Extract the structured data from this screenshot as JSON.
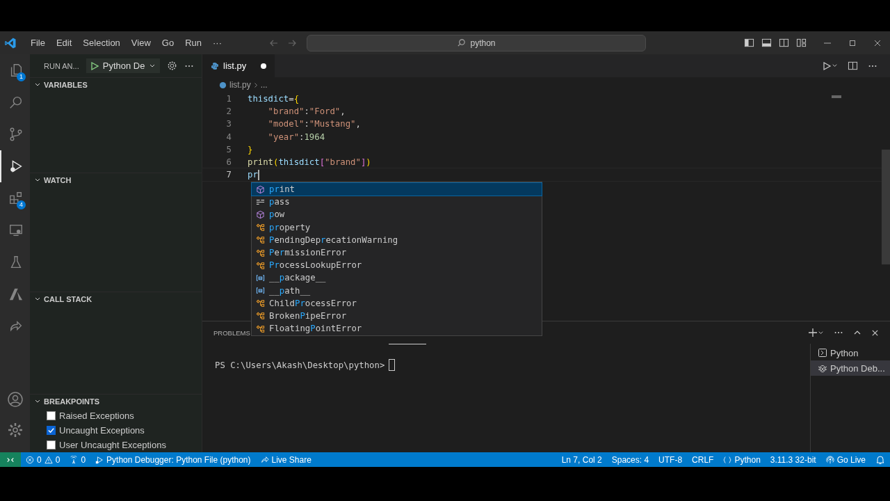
{
  "menu": [
    "File",
    "Edit",
    "Selection",
    "View",
    "Go",
    "Run",
    "···"
  ],
  "search": {
    "value": "python"
  },
  "activity_bar": [
    {
      "kind": "explorer",
      "badge": "1",
      "selected": false
    },
    {
      "kind": "search",
      "selected": false
    },
    {
      "kind": "scm",
      "selected": false
    },
    {
      "kind": "debug",
      "selected": true
    },
    {
      "kind": "extensions",
      "badge": "4",
      "selected": false
    },
    {
      "kind": "remote",
      "selected": false
    },
    {
      "kind": "testing",
      "selected": false
    },
    {
      "kind": "azure",
      "selected": false
    },
    {
      "kind": "liveshare",
      "selected": false
    }
  ],
  "sidebar": {
    "title": "RUN AN...",
    "config": "Python De",
    "sections": [
      {
        "title": "VARIABLES",
        "expanded": true
      },
      {
        "title": "WATCH",
        "expanded": true
      },
      {
        "title": "CALL STACK",
        "expanded": true
      },
      {
        "title": "BREAKPOINTS",
        "expanded": true
      }
    ],
    "breakpoints": [
      {
        "label": "Raised Exceptions",
        "checked": false
      },
      {
        "label": "Uncaught Exceptions",
        "checked": true
      },
      {
        "label": "User Uncaught Exceptions",
        "checked": false
      }
    ]
  },
  "editor": {
    "tab": {
      "label": "list.py",
      "modified": true
    },
    "breadcrumb": [
      "list.py",
      "..."
    ],
    "lines": [
      {
        "number": "1",
        "tokens": [
          {
            "t": "thisdict",
            "kind": "var"
          },
          {
            "t": "=",
            "kind": "op"
          },
          {
            "t": "{",
            "kind": "brace"
          }
        ]
      },
      {
        "number": "2",
        "tokens": [
          {
            "t": "    \"brand\"",
            "kind": "str"
          },
          {
            "t": ":",
            "kind": "op"
          },
          {
            "t": "\"Ford\"",
            "kind": "str"
          },
          {
            "t": ",",
            "kind": "op"
          }
        ]
      },
      {
        "number": "3",
        "tokens": [
          {
            "t": "    \"model\"",
            "kind": "str"
          },
          {
            "t": ":",
            "kind": "op"
          },
          {
            "t": "\"Mustang\"",
            "kind": "str"
          },
          {
            "t": ",",
            "kind": "op"
          }
        ]
      },
      {
        "number": "4",
        "tokens": [
          {
            "t": "    \"year\"",
            "kind": "str"
          },
          {
            "t": ":",
            "kind": "op"
          },
          {
            "t": "1964",
            "kind": "num"
          }
        ]
      },
      {
        "number": "5",
        "tokens": [
          {
            "t": "}",
            "kind": "brace"
          }
        ]
      },
      {
        "number": "6",
        "tokens": [
          {
            "t": "print",
            "kind": "fn"
          },
          {
            "t": "(",
            "kind": "brace"
          },
          {
            "t": "thisdict",
            "kind": "var"
          },
          {
            "t": "[",
            "kind": "brace2"
          },
          {
            "t": "\"brand\"",
            "kind": "str"
          },
          {
            "t": "]",
            "kind": "brace2"
          },
          {
            "t": ")",
            "kind": "brace"
          }
        ]
      },
      {
        "number": "7",
        "tokens": [
          {
            "t": "pr",
            "kind": "var"
          }
        ],
        "current": true
      }
    ],
    "suggestions": [
      {
        "label": "**pr**int",
        "kind": "function",
        "selected": true
      },
      {
        "label": "**p**ass",
        "kind": "keyword",
        "selected": false
      },
      {
        "label": "**p**ow",
        "kind": "function",
        "selected": false
      },
      {
        "label": "**pr**operty",
        "kind": "class",
        "selected": false
      },
      {
        "label": "**P**endingDep**r**ecationWarning",
        "kind": "class",
        "selected": false
      },
      {
        "label": "**P**e**r**missionError",
        "kind": "class",
        "selected": false
      },
      {
        "label": "**Pr**ocessLookupError",
        "kind": "class",
        "selected": false
      },
      {
        "label": "__**p**ackage__",
        "kind": "variable",
        "selected": false
      },
      {
        "label": "__**p**ath__",
        "kind": "variable",
        "selected": false
      },
      {
        "label": "Child**Pr**ocessError",
        "kind": "class",
        "selected": false
      },
      {
        "label": "Broken**P**ipeError",
        "kind": "class",
        "selected": false
      },
      {
        "label": "Floating**P**ointError",
        "kind": "class",
        "selected": false
      }
    ]
  },
  "panel": {
    "tab": "PROBLEMS",
    "prompt": "PS C:\\Users\\Akash\\Desktop\\python>",
    "terminals": [
      {
        "label": "Python",
        "kind": "shell",
        "selected": false
      },
      {
        "label": "Python Deb...",
        "kind": "debug",
        "selected": true
      }
    ]
  },
  "status_bar": {
    "errors": "0",
    "warnings": "0",
    "ports": "0",
    "debug": "Python Debugger: Python File (python)",
    "liveshare": "Live Share",
    "position": "Ln 7, Col 2",
    "spaces": "Spaces: 4",
    "encoding": "UTF-8",
    "eol": "CRLF",
    "language": "Python",
    "interpreter": "3.11.3 32-bit",
    "golive": "Go Live"
  }
}
